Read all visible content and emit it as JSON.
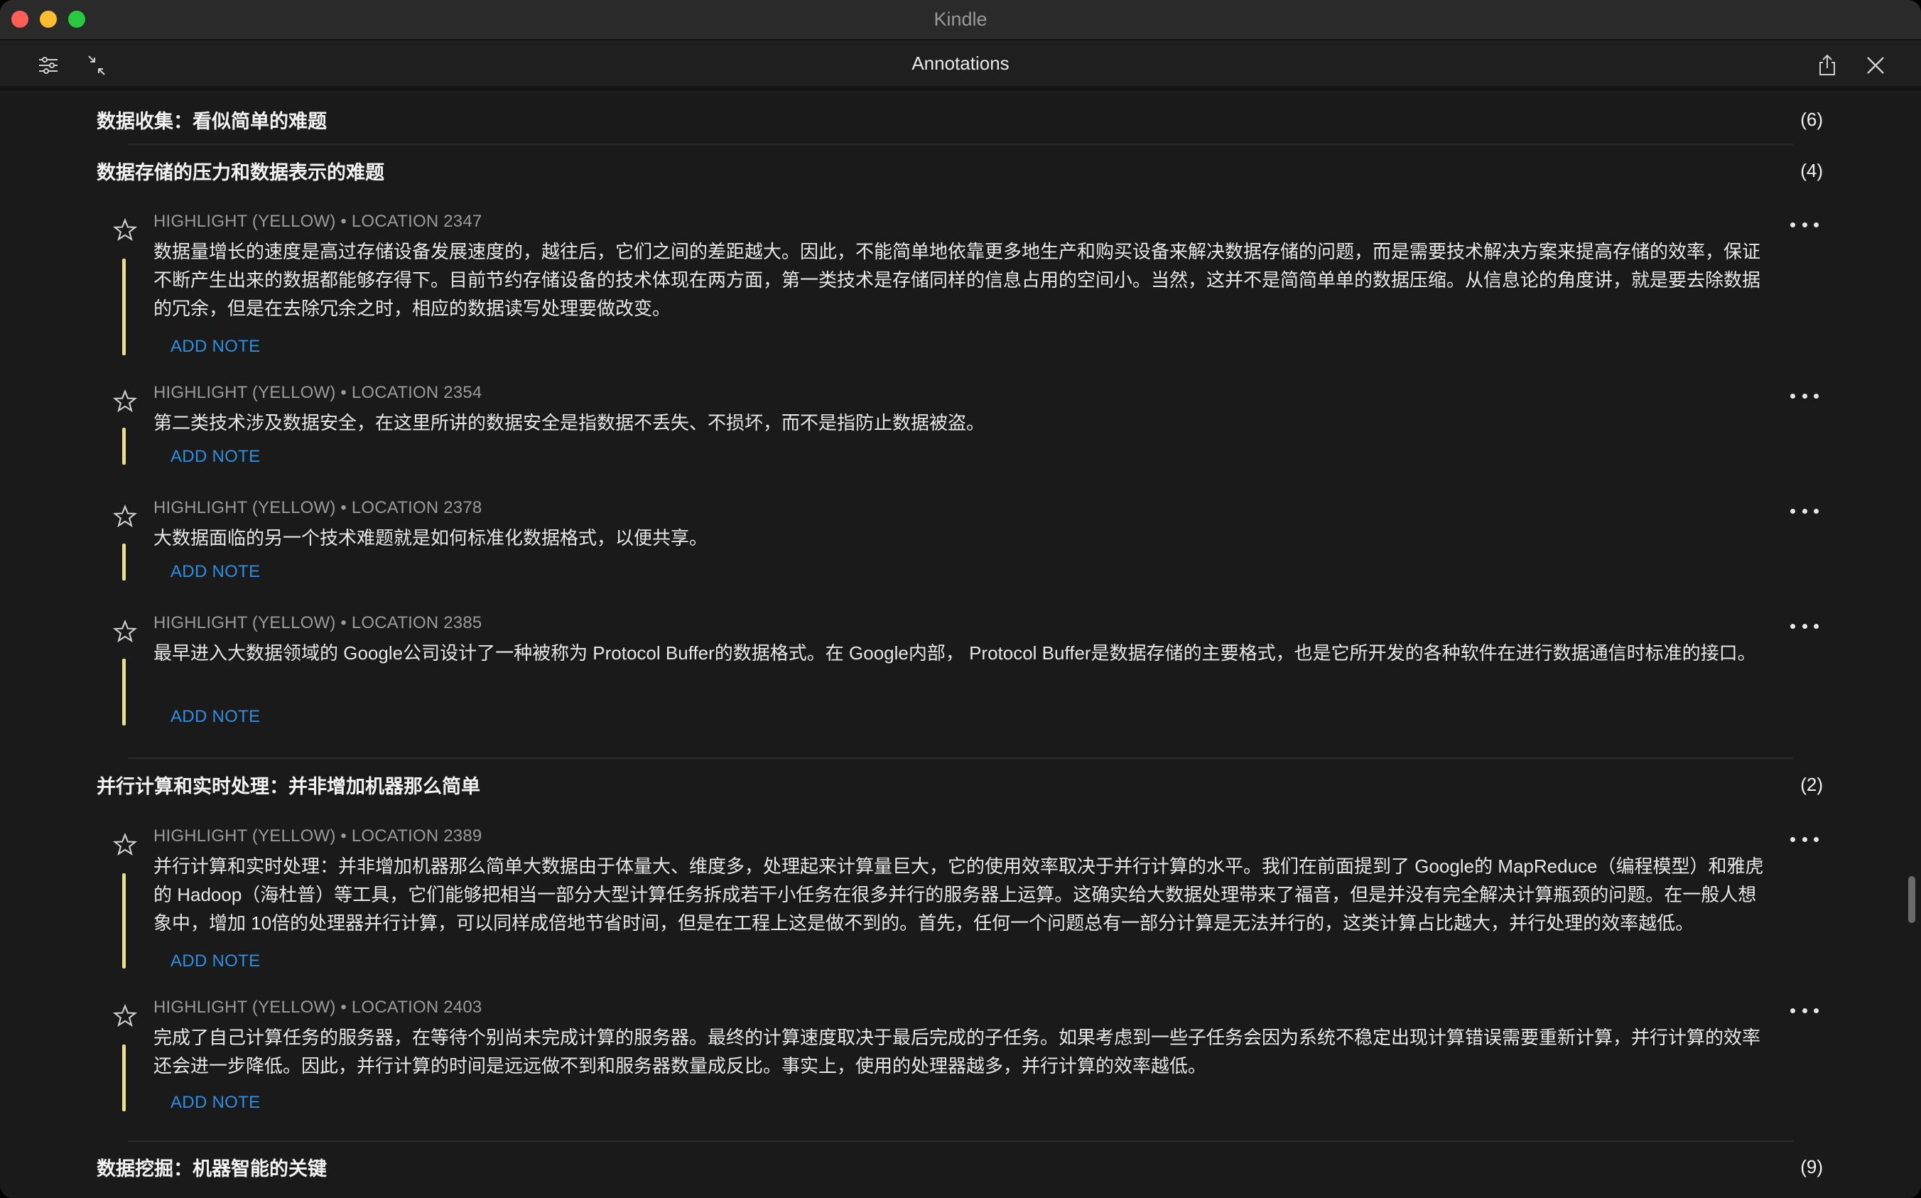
{
  "window": {
    "title": "Kindle"
  },
  "toolbar": {
    "title": "Annotations",
    "filter_icon": "sliders-icon",
    "collapse_icon": "collapse-arrows-icon",
    "share_icon": "share-icon",
    "close_icon": "close-icon"
  },
  "sections": [
    {
      "title": "数据收集：看似简单的难题",
      "count": "(6)"
    },
    {
      "title": "数据存储的压力和数据表示的难题",
      "count": "(4)"
    },
    {
      "title": "并行计算和实时处理：并非增加机器那么简单",
      "count": "(2)"
    },
    {
      "title": "数据挖掘：机器智能的关键",
      "count": "(9)"
    }
  ],
  "annotations": [
    {
      "meta": "HIGHLIGHT (YELLOW) • LOCATION 2347",
      "text": "数据量增长的速度是高过存储设备发展速度的，越往后，它们之间的差距越大。因此，不能简单地依靠更多地生产和购买设备来解决数据存储的问题，而是需要技术解决方案来提高存储的效率，保证不断产生出来的数据都能够存得下。目前节约存储设备的技术体现在两方面，第一类技术是存储同样的信息占用的空间小。当然，这并不是简简单单的数据压缩。从信息论的角度讲，就是要去除数据的冗余，但是在去除冗余之时，相应的数据读写处理要做改变。",
      "add_note": "ADD NOTE"
    },
    {
      "meta": "HIGHLIGHT (YELLOW) • LOCATION 2354",
      "text": "第二类技术涉及数据安全，在这里所讲的数据安全是指数据不丢失、不损坏，而不是指防止数据被盗。",
      "add_note": "ADD NOTE"
    },
    {
      "meta": "HIGHLIGHT (YELLOW) • LOCATION 2378",
      "text": "大数据面临的另一个技术难题就是如何标准化数据格式，以便共享。",
      "add_note": "ADD NOTE"
    },
    {
      "meta": "HIGHLIGHT (YELLOW) • LOCATION 2385",
      "text": "最早进入大数据领域的 Google公司设计了一种被称为 Protocol Buffer的数据格式。在 Google内部， Protocol Buffer是数据存储的主要格式，也是它所开发的各种软件在进行数据通信时标准的接口。",
      "add_note": "ADD NOTE"
    },
    {
      "meta": "HIGHLIGHT (YELLOW) • LOCATION 2389",
      "text": "并行计算和实时处理：并非增加机器那么简单大数据由于体量大、维度多，处理起来计算量巨大，它的使用效率取决于并行计算的水平。我们在前面提到了 Google的 MapReduce（编程模型）和雅虎的 Hadoop（海杜普）等工具，它们能够把相当一部分大型计算任务拆成若干小任务在很多并行的服务器上运算。这确实给大数据处理带来了福音，但是并没有完全解决计算瓶颈的问题。在一般人想象中，增加 10倍的处理器并行计算，可以同样成倍地节省时间，但是在工程上这是做不到的。首先，任何一个问题总有一部分计算是无法并行的，这类计算占比越大，并行处理的效率越低。",
      "add_note": "ADD NOTE"
    },
    {
      "meta": "HIGHLIGHT (YELLOW) • LOCATION 2403",
      "text": "完成了自己计算任务的服务器，在等待个别尚未完成计算的服务器。最终的计算速度取决于最后完成的子任务。如果考虑到一些子任务会因为系统不稳定出现计算错误需要重新计算，并行计算的效率还会进一步降低。因此，并行计算的时间是远远做不到和服务器数量成反比。事实上，使用的处理器越多，并行计算的效率越低。",
      "add_note": "ADD NOTE"
    }
  ],
  "colors": {
    "highlight": "#e9de8a",
    "link": "#2e8fe0"
  }
}
